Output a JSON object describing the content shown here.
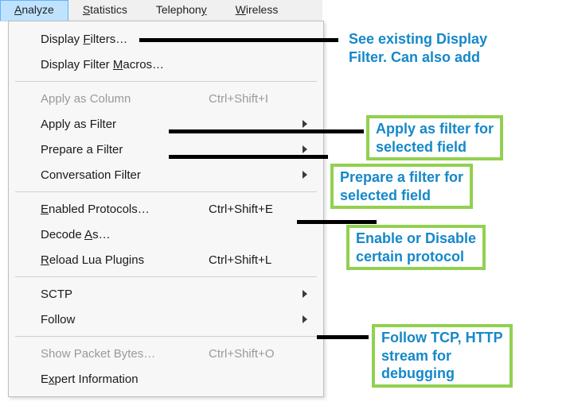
{
  "menubar": {
    "items": [
      {
        "pre": "",
        "u": "A",
        "post": "nalyze"
      },
      {
        "pre": "",
        "u": "S",
        "post": "tatistics"
      },
      {
        "pre": "Telephon",
        "u": "y",
        "post": ""
      },
      {
        "pre": "",
        "u": "W",
        "post": "ireless"
      }
    ]
  },
  "menu": {
    "display_filters": {
      "pre": "Display ",
      "u": "F",
      "post": "ilters…",
      "shortcut": ""
    },
    "display_filter_macros": {
      "pre": "Display Filter ",
      "u": "M",
      "post": "acros…",
      "shortcut": ""
    },
    "apply_as_column": {
      "label": "Apply as Column",
      "shortcut": "Ctrl+Shift+I"
    },
    "apply_as_filter": {
      "label": "Apply as Filter",
      "shortcut": ""
    },
    "prepare_a_filter": {
      "label": "Prepare a Filter",
      "shortcut": ""
    },
    "conversation_filter": {
      "label": "Conversation Filter",
      "shortcut": ""
    },
    "enabled_protocols": {
      "pre": "",
      "u": "E",
      "post": "nabled Protocols…",
      "shortcut": "Ctrl+Shift+E"
    },
    "decode_as": {
      "pre": "Decode ",
      "u": "A",
      "post": "s…",
      "shortcut": ""
    },
    "reload_lua": {
      "pre": "",
      "u": "R",
      "post": "eload Lua Plugins",
      "shortcut": "Ctrl+Shift+L"
    },
    "sctp": {
      "label": "SCTP",
      "shortcut": ""
    },
    "follow": {
      "label": "Follow",
      "shortcut": ""
    },
    "show_packet_bytes": {
      "label": "Show Packet Bytes…",
      "shortcut": "Ctrl+Shift+O"
    },
    "expert_info": {
      "pre": "E",
      "u": "x",
      "post": "pert Information",
      "shortcut": ""
    }
  },
  "callouts": {
    "display_filters": "See existing Display\nFilter. Can also add",
    "apply_as_filter": "Apply as filter for\nselected field",
    "prepare_a_filter": "Prepare a filter for\nselected field",
    "enabled_protocols": "Enable or Disable\ncertain protocol",
    "follow": "Follow TCP, HTTP\nstream for\ndebugging"
  }
}
